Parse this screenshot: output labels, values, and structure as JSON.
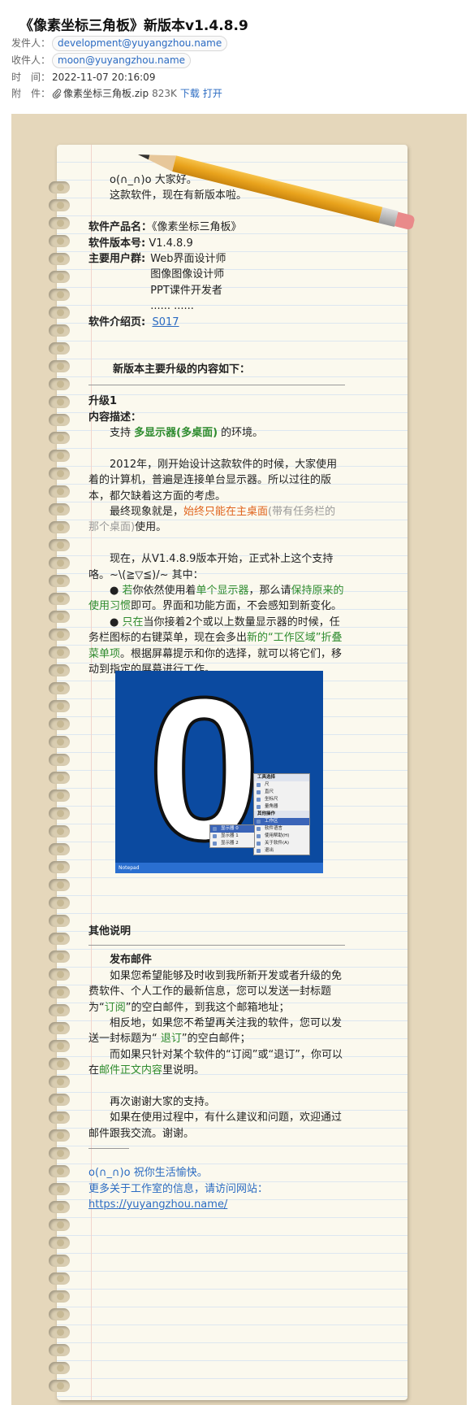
{
  "header": {
    "subject": "《像素坐标三角板》新版本v1.4.8.9",
    "from_label": "发件人：",
    "from_value": "development@yuyangzhou.name",
    "to_label": "收件人：",
    "to_value": "moon@yuyangzhou.name",
    "time_label": "时　间：",
    "time_value": "2022-11-07 20:16:09",
    "attach_label": "附　件：",
    "attach_name": "像素坐标三角板.zip",
    "attach_size": "823K",
    "download_label": "下载",
    "open_label": "打开"
  },
  "body": {
    "greet1": "o(∩_∩)o  大家好。",
    "greet2": "这款软件，现在有新版本啦。",
    "prod_label": "软件产品名：",
    "prod_value": "《像素坐标三角板》",
    "ver_label": "软件版本号:",
    "ver_value": "V1.4.8.9",
    "users_label": "主要用户群:",
    "users": [
      "Web界面设计师",
      "图像图像设计师",
      "PPT课件开发者",
      "......      ......"
    ],
    "intro_label": "软件介绍页:",
    "intro_link": "S017",
    "update_title": "新版本主要升级的内容如下：",
    "up1_title": "升级1",
    "desc_label": "内容描述：",
    "support_a": "支持 ",
    "support_b": "多显示器(多桌面)",
    "support_c": " 的环境。",
    "p2012": "2012年，刚开始设计这款软件的时候，大家使用着的计算机，普遍是连接单台显示器。所以过往的版本，都欠缺着这方面的考虑。",
    "final_a": "最终现象就是，",
    "final_b": "始终只能在主桌面",
    "final_c": "(带有任务栏的那个桌面)",
    "final_d": "使用。",
    "now_text": "现在，从V1.4.8.9版本开始，正式补上这个支持咯。~\\(≧▽≦)/~  其中：",
    "b1_a": "● ",
    "b1_b": "若",
    "b1_c": "你依然使用着",
    "b1_d": "单个显示器",
    "b1_e": "，那么请",
    "b1_f": "保持原来的使用习惯",
    "b1_g": "即可。界面和功能方面，不会感知到新变化。",
    "b2_a": "● ",
    "b2_b": "只在",
    "b2_c": "当你接着2个或以上数量显示器的时候，任务栏图标的右键菜单，现在会多出",
    "b2_d": "新的“工作区域”折叠菜单项",
    "b2_e": "。根据屏幕提示和你的选择，就可以将它们，移动到指定的屏幕进行工作。",
    "screenshot": {
      "big_letter": "0",
      "taskbar_text": "Notepad",
      "menu_tools_header": "工具选择",
      "menu_tools": [
        "尺",
        "直尺",
        "坐标尺",
        "量角器"
      ],
      "menu_other_header": "其他操作",
      "menu_other": [
        "工作区",
        "软件语言",
        "使用帮助(H)",
        "关于软件(A)",
        "退出"
      ],
      "submenu": [
        "显示器 0",
        "显示器 1",
        "显示器 2"
      ]
    },
    "other_title": "其他说明",
    "publish_title": "发布邮件",
    "pub1_a": "如果您希望能够及时收到我所新开发或者升级的免费软件、个人工作的最新信息，您可以发送一封标题为“",
    "pub1_b": "订阅",
    "pub1_c": "”的空白邮件，到我这个邮箱地址；",
    "pub2_a": "相反地，如果您不希望再关注我的软件，您可以发送一封标题为“ ",
    "pub2_b": "退订",
    "pub2_c": "”的空白邮件；",
    "pub3_a": "而如果只针对某个软件的“订阅”或“退订”，你可以在",
    "pub3_b": "邮件正文内容",
    "pub3_c": "里说明。",
    "thanks1": "再次谢谢大家的支持。",
    "thanks2": "如果在使用过程中，有什么建议和问题，欢迎通过邮件跟我交流。谢谢。",
    "sig1": "o(∩_∩)o  祝你生活愉快。",
    "sig2": "更多关于工作室的信息，请访问网站：",
    "sig_link": "https://yuyangzhou.name/"
  }
}
